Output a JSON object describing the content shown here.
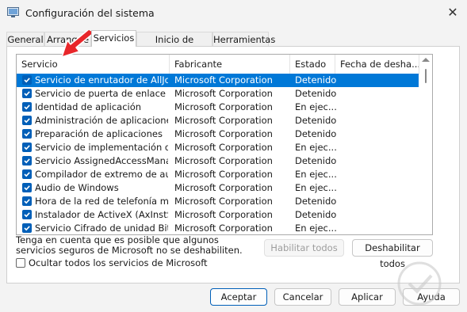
{
  "window": {
    "title": "Configuración del sistema",
    "close_glyph": "✕"
  },
  "tabs": [
    "General",
    "Arranque",
    "Servicios",
    "Inicio de Windows",
    "Herramientas"
  ],
  "active_tab": "Servicios",
  "columns": [
    "Servicio",
    "Fabricante",
    "Estado",
    "Fecha de desha..."
  ],
  "services": [
    {
      "name": "Servicio de enrutador de AllJoyn",
      "maker": "Microsoft Corporation",
      "status": "Detenido",
      "checked": true
    },
    {
      "name": "Servicio de puerta de enlace de ...",
      "maker": "Microsoft Corporation",
      "status": "Detenido",
      "checked": true
    },
    {
      "name": "Identidad de aplicación",
      "maker": "Microsoft Corporation",
      "status": "En ejec...",
      "checked": true
    },
    {
      "name": "Administración de aplicaciones",
      "maker": "Microsoft Corporation",
      "status": "Detenido",
      "checked": true
    },
    {
      "name": "Preparación de aplicaciones",
      "maker": "Microsoft Corporation",
      "status": "Detenido",
      "checked": true
    },
    {
      "name": "Servicio de implementación de A...",
      "maker": "Microsoft Corporation",
      "status": "En ejec...",
      "checked": true
    },
    {
      "name": "Servicio AssignedAccessManager",
      "maker": "Microsoft Corporation",
      "status": "Detenido",
      "checked": true
    },
    {
      "name": "Compilador de extremo de audio...",
      "maker": "Microsoft Corporation",
      "status": "En ejec...",
      "checked": true
    },
    {
      "name": "Audio de Windows",
      "maker": "Microsoft Corporation",
      "status": "En ejec...",
      "checked": true
    },
    {
      "name": "Hora de la red de telefonía móvil",
      "maker": "Microsoft Corporation",
      "status": "Detenido",
      "checked": true
    },
    {
      "name": "Instalador de ActiveX (AxInstSV)",
      "maker": "Microsoft Corporation",
      "status": "Detenido",
      "checked": true
    },
    {
      "name": "Servicio Cifrado de unidad BitLoc...",
      "maker": "Microsoft Corporation",
      "status": "En ejec...",
      "checked": true
    }
  ],
  "selected_index": 0,
  "note": "Tenga en cuenta que es posible que algunos servicios seguros de Microsoft no se deshabiliten.",
  "buttons": {
    "enable_all": "Habilitar todos",
    "disable_all": "Deshabilitar todos",
    "accept": "Aceptar",
    "cancel": "Cancelar",
    "apply": "Aplicar",
    "help": "Ayuda"
  },
  "hide_ms_label": "Ocultar todos los servicios de Microsoft",
  "hide_ms_checked": false,
  "colors": {
    "accent": "#005fb8",
    "selection": "#0078d7",
    "annotation_arrow": "#e8262a"
  }
}
